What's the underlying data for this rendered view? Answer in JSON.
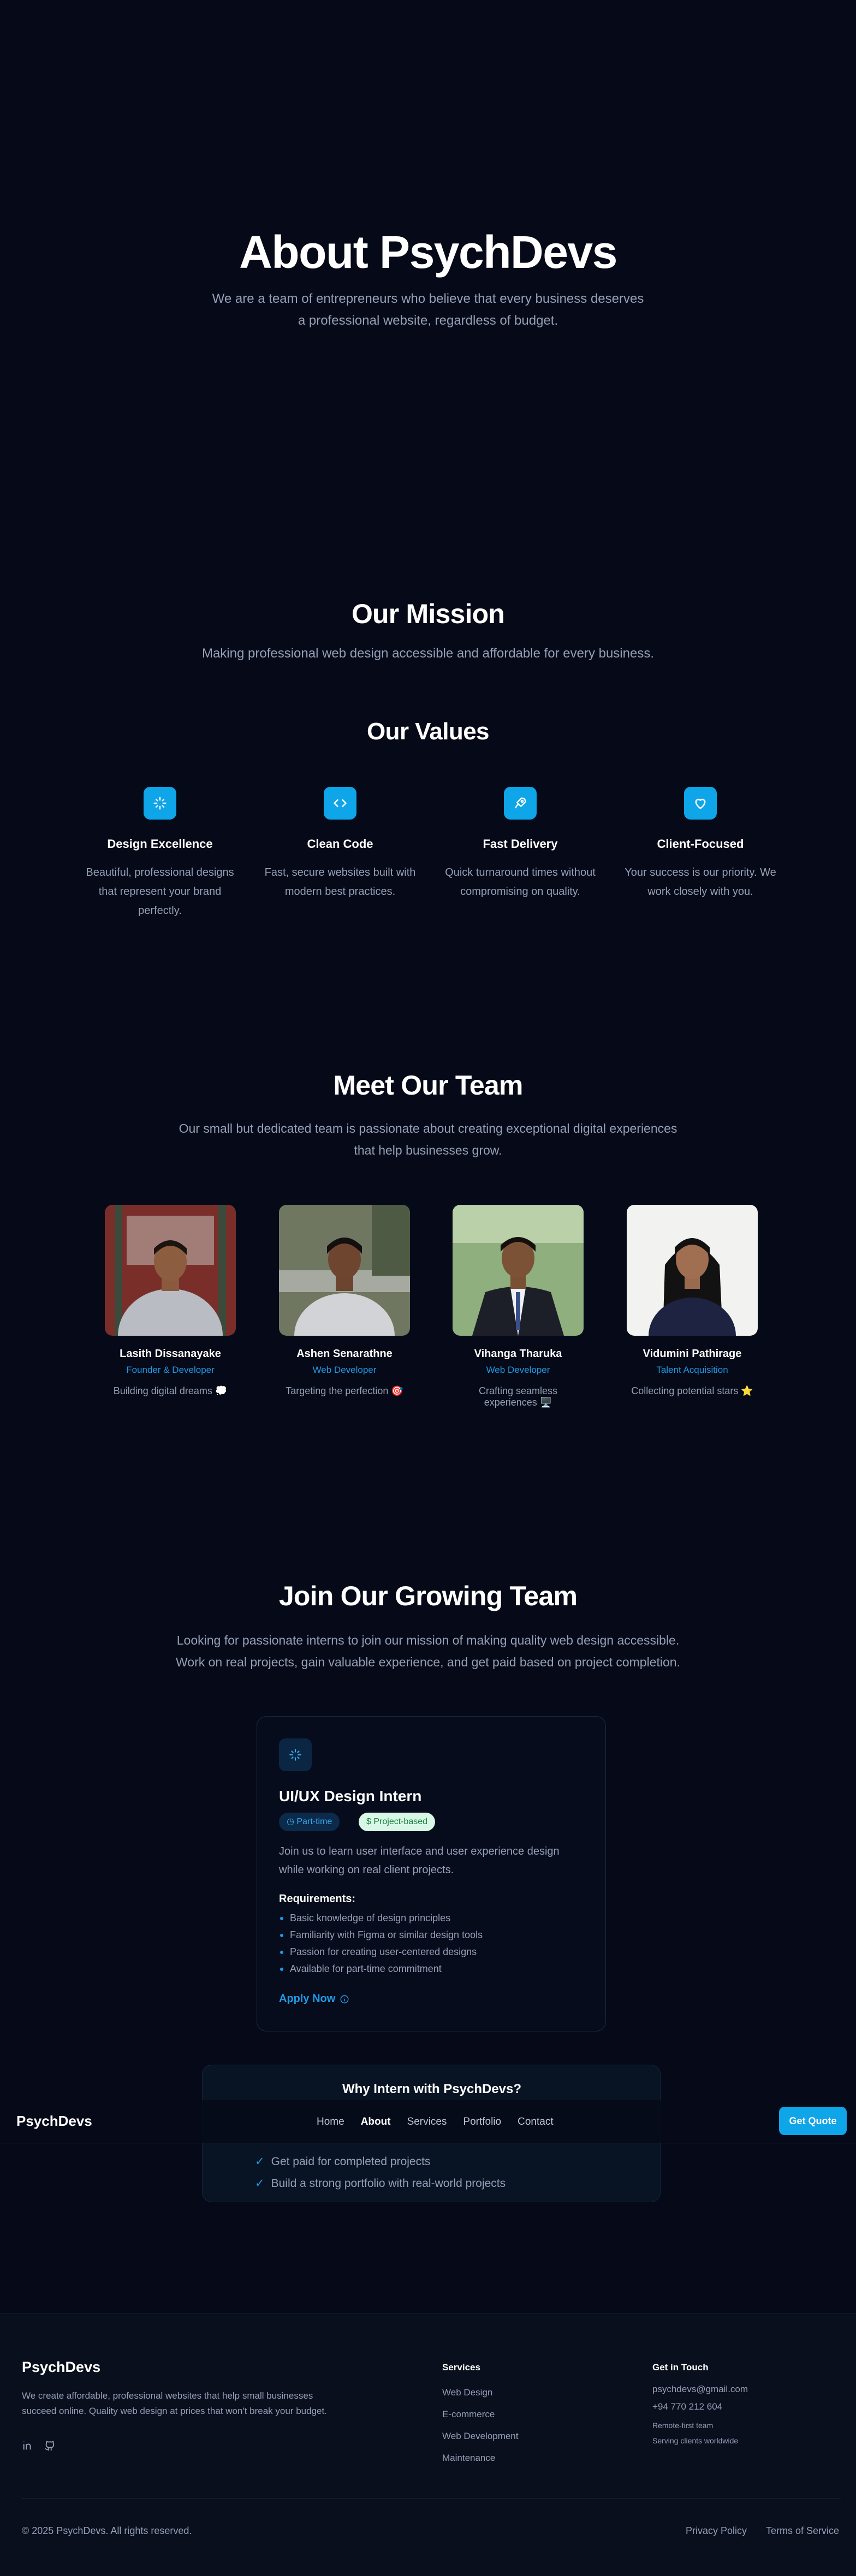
{
  "hero": {
    "title": "About PsychDevs",
    "subtitle": "We are a team of entrepreneurs who believe that every business deserves a professional website, regardless of budget."
  },
  "mission": {
    "title": "Our Mission",
    "text": "Making professional web design accessible and affordable for every business."
  },
  "values": {
    "title": "Our Values",
    "items": [
      {
        "icon": "sparkles-icon",
        "title": "Design Excellence",
        "text": "Beautiful, professional designs that represent your brand perfectly."
      },
      {
        "icon": "code-icon",
        "title": "Clean Code",
        "text": "Fast, secure websites built with modern best practices."
      },
      {
        "icon": "rocket-icon",
        "title": "Fast Delivery",
        "text": "Quick turnaround times without compromising on quality."
      },
      {
        "icon": "heart-icon",
        "title": "Client-Focused",
        "text": "Your success is our priority. We work closely with you."
      }
    ]
  },
  "team": {
    "title": "Meet Our Team",
    "subtitle": "Our small but dedicated team is passionate about creating exceptional digital experiences that help businesses grow.",
    "members": [
      {
        "name": "Lasith Dissanayake",
        "role": "Founder & Developer",
        "tagline": "Building digital dreams 💭"
      },
      {
        "name": "Ashen Senarathne",
        "role": "Web Developer",
        "tagline": "Targeting the perfection 🎯"
      },
      {
        "name": "Vihanga Tharuka",
        "role": "Web Developer",
        "tagline": "Crafting seamless experiences 🖥️"
      },
      {
        "name": "Vidumini Pathirage",
        "role": "Talent Acquisition",
        "tagline": "Collecting potential stars ⭐"
      }
    ]
  },
  "join": {
    "title": "Join Our Growing Team",
    "subtitle": "Looking for passionate interns to join our mission of making quality web design accessible. Work on real projects, gain valuable experience, and get paid based on project completion.",
    "job": {
      "icon": "sparkles-icon",
      "title": "UI/UX Design Intern",
      "badge_time": "Part-time",
      "badge_paid": "Project-based",
      "description": "Join us to learn user interface and user experience design while working on real client projects.",
      "requirements_title": "Requirements:",
      "requirements": [
        "Basic knowledge of design principles",
        "Familiarity with Figma or similar design tools",
        "Passion for creating user-centered designs",
        "Available for part-time commitment"
      ],
      "apply_label": "Apply Now"
    },
    "why": {
      "title": "Why Intern with PsychDevs?",
      "items": [
        "Get paid for completed projects",
        "Build a strong portfolio with real-world projects"
      ]
    }
  },
  "navbar": {
    "logo": "PsychDevs",
    "links": [
      "Home",
      "About",
      "Services",
      "Portfolio",
      "Contact"
    ],
    "active": "About",
    "cta": "Get Quote"
  },
  "footer": {
    "brand": "PsychDevs",
    "description": "We create affordable, professional websites that help small businesses succeed online. Quality web design at prices that won't break your budget.",
    "social": [
      "linkedin-icon",
      "github-icon"
    ],
    "services_title": "Services",
    "services": [
      "Web Design",
      "E-commerce",
      "Web Development",
      "Maintenance"
    ],
    "contact_title": "Get in Touch",
    "email": "psychdevs@gmail.com",
    "phone": "+94 770 212 604",
    "note1": "Remote-first team",
    "note2": "Serving clients worldwide",
    "copyright": "© 2025 PsychDevs. All rights reserved.",
    "privacy": "Privacy Policy",
    "terms": "Terms of Service"
  },
  "colors": {
    "background": "#060a18",
    "accent": "#0ea5e9",
    "muted_text": "#95a0b6"
  }
}
